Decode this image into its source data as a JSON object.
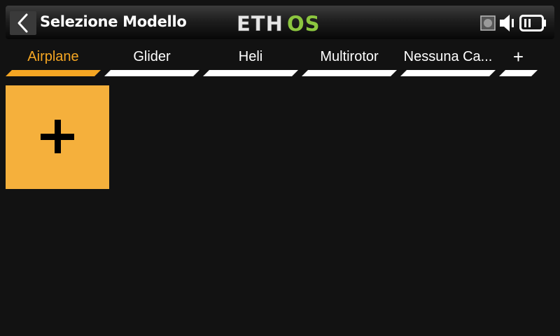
{
  "header": {
    "title": "Selezione Modello",
    "back_icon": "chevron-left-icon",
    "logo": {
      "text_white": "ETH",
      "text_green": "OS",
      "white_color": "#e6e6e6",
      "green_color": "#8cc63f"
    },
    "status_icons": [
      "record-indicator-icon",
      "speaker-icon",
      "battery-icon"
    ]
  },
  "tabs": [
    {
      "label": "Airplane",
      "active": true
    },
    {
      "label": "Glider",
      "active": false
    },
    {
      "label": "Heli",
      "active": false
    },
    {
      "label": "Multirotor",
      "active": false
    },
    {
      "label": "Nessuna Ca...",
      "active": false
    }
  ],
  "add_tab": {
    "label": "+"
  },
  "models": {
    "add_tile_icon": "plus-icon"
  },
  "colors": {
    "background": "#121212",
    "accent": "#f5a623",
    "tile": "#f5b03c",
    "tab_underline": "#ffffff",
    "text": "#ffffff"
  }
}
